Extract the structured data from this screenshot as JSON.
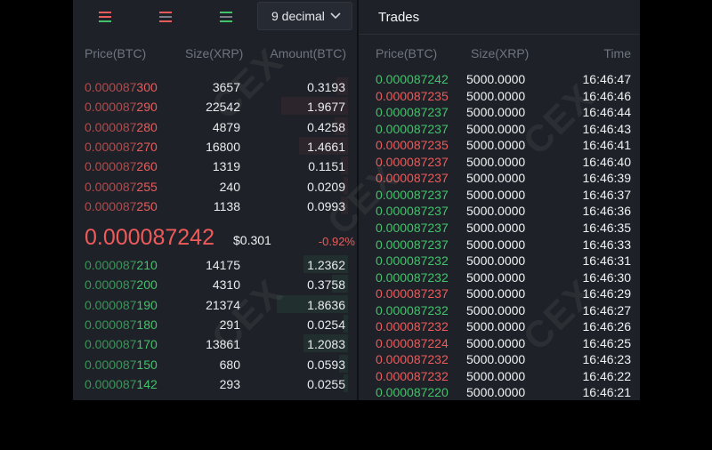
{
  "orderbook": {
    "decimal_select": "9 decimal",
    "headers": {
      "price": "Price(BTC)",
      "size": "Size(XRP)",
      "amount": "Amount(BTC)"
    },
    "view_buttons": [
      "orderbook-both",
      "orderbook-sells",
      "orderbook-buys"
    ],
    "asks": [
      {
        "price_main": "0.000087",
        "price_tail": "300",
        "size": "3657",
        "amount": "0.3193",
        "depth": 0.05
      },
      {
        "price_main": "0.000087",
        "price_tail": "290",
        "size": "22542",
        "amount": "1.9677",
        "depth": 0.3
      },
      {
        "price_main": "0.000087",
        "price_tail": "280",
        "size": "4879",
        "amount": "0.4258",
        "depth": 0.06
      },
      {
        "price_main": "0.000087",
        "price_tail": "270",
        "size": "16800",
        "amount": "1.4661",
        "depth": 0.22
      },
      {
        "price_main": "0.000087",
        "price_tail": "260",
        "size": "1319",
        "amount": "0.1151",
        "depth": 0.03
      },
      {
        "price_main": "0.000087",
        "price_tail": "255",
        "size": "240",
        "amount": "0.0209",
        "depth": 0.02
      },
      {
        "price_main": "0.000087",
        "price_tail": "250",
        "size": "1138",
        "amount": "0.0993",
        "depth": 0.03
      }
    ],
    "last_price": "0.000087242",
    "last_usd": "$0.301",
    "change": "-0.92%",
    "bids": [
      {
        "price_main": "0.000087",
        "price_tail": "210",
        "size": "14175",
        "amount": "1.2362",
        "depth": 0.2
      },
      {
        "price_main": "0.000087",
        "price_tail": "200",
        "size": "4310",
        "amount": "0.3758",
        "depth": 0.07
      },
      {
        "price_main": "0.000087",
        "price_tail": "190",
        "size": "21374",
        "amount": "1.8636",
        "depth": 0.32
      },
      {
        "price_main": "0.000087",
        "price_tail": "180",
        "size": "291",
        "amount": "0.0254",
        "depth": 0.02
      },
      {
        "price_main": "0.000087",
        "price_tail": "170",
        "size": "13861",
        "amount": "1.2083",
        "depth": 0.2
      },
      {
        "price_main": "0.000087",
        "price_tail": "150",
        "size": "680",
        "amount": "0.0593",
        "depth": 0.04
      },
      {
        "price_main": "0.000087",
        "price_tail": "142",
        "size": "293",
        "amount": "0.0255",
        "depth": 0.02
      }
    ]
  },
  "trades": {
    "title": "Trades",
    "headers": {
      "price": "Price(BTC)",
      "size": "Size(XRP)",
      "time": "Time"
    },
    "rows": [
      {
        "price": "0.000087242",
        "size": "5000.0000",
        "time": "16:46:47",
        "side": "buy"
      },
      {
        "price": "0.000087235",
        "size": "5000.0000",
        "time": "16:46:46",
        "side": "sell"
      },
      {
        "price": "0.000087237",
        "size": "5000.0000",
        "time": "16:46:44",
        "side": "buy"
      },
      {
        "price": "0.000087237",
        "size": "5000.0000",
        "time": "16:46:43",
        "side": "buy"
      },
      {
        "price": "0.000087235",
        "size": "5000.0000",
        "time": "16:46:41",
        "side": "sell"
      },
      {
        "price": "0.000087237",
        "size": "5000.0000",
        "time": "16:46:40",
        "side": "sell"
      },
      {
        "price": "0.000087237",
        "size": "5000.0000",
        "time": "16:46:39",
        "side": "sell"
      },
      {
        "price": "0.000087237",
        "size": "5000.0000",
        "time": "16:46:37",
        "side": "buy"
      },
      {
        "price": "0.000087237",
        "size": "5000.0000",
        "time": "16:46:36",
        "side": "buy"
      },
      {
        "price": "0.000087237",
        "size": "5000.0000",
        "time": "16:46:35",
        "side": "buy"
      },
      {
        "price": "0.000087237",
        "size": "5000.0000",
        "time": "16:46:33",
        "side": "buy"
      },
      {
        "price": "0.000087232",
        "size": "5000.0000",
        "time": "16:46:31",
        "side": "buy"
      },
      {
        "price": "0.000087232",
        "size": "5000.0000",
        "time": "16:46:30",
        "side": "buy"
      },
      {
        "price": "0.000087237",
        "size": "5000.0000",
        "time": "16:46:29",
        "side": "sell"
      },
      {
        "price": "0.000087232",
        "size": "5000.0000",
        "time": "16:46:27",
        "side": "buy"
      },
      {
        "price": "0.000087232",
        "size": "5000.0000",
        "time": "16:46:26",
        "side": "sell"
      },
      {
        "price": "0.000087224",
        "size": "5000.0000",
        "time": "16:46:25",
        "side": "sell"
      },
      {
        "price": "0.000087232",
        "size": "5000.0000",
        "time": "16:46:23",
        "side": "sell"
      },
      {
        "price": "0.000087232",
        "size": "5000.0000",
        "time": "16:46:22",
        "side": "sell"
      },
      {
        "price": "0.000087220",
        "size": "5000.0000",
        "time": "16:46:21",
        "side": "buy"
      }
    ]
  },
  "colors": {
    "buy": "#44c16b",
    "sell": "#ea5b5b",
    "panel": "#1e2228",
    "text": "#e9ebee",
    "muted": "#6d7480"
  }
}
